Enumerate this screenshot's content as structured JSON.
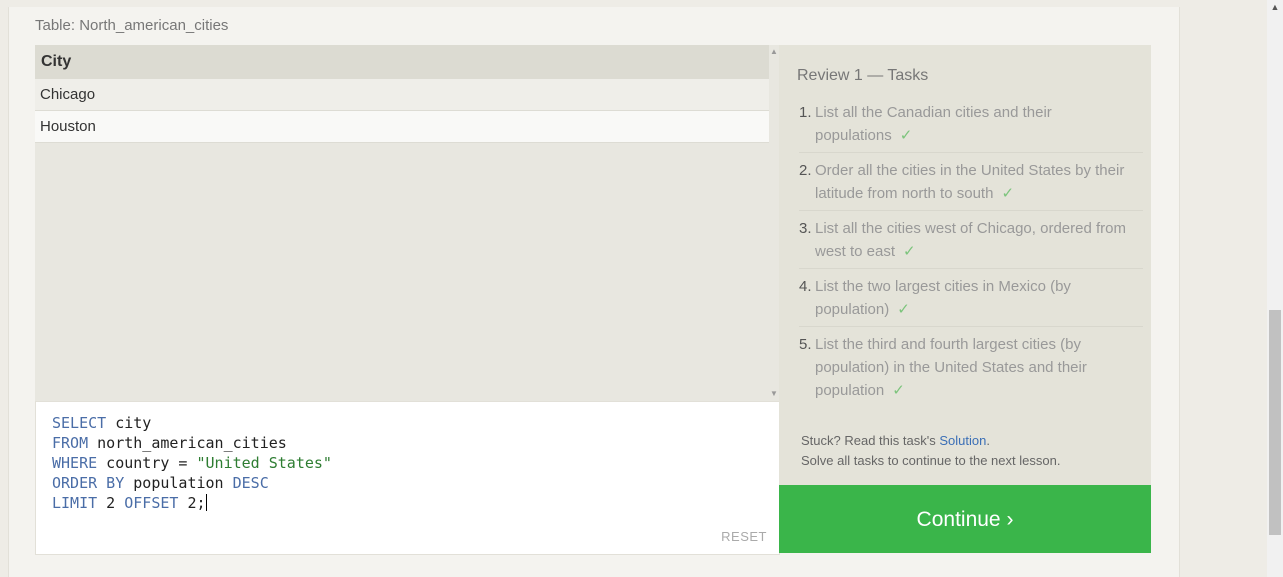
{
  "table_label": "Table: North_american_cities",
  "results": {
    "column": "City",
    "rows": [
      "Chicago",
      "Houston"
    ]
  },
  "editor": {
    "lines": [
      {
        "kw": "SELECT",
        "rest": " city"
      },
      {
        "kw": "FROM",
        "rest": " north_american_cities"
      },
      {
        "kw": "WHERE",
        "rest": " country = ",
        "str": "\"United States\""
      },
      {
        "kw": "ORDER BY",
        "rest": " population ",
        "kw2": "DESC"
      },
      {
        "kw": "LIMIT",
        "rest": " 2 ",
        "kw2": "OFFSET",
        "rest2": " 2;"
      }
    ],
    "reset_label": "RESET"
  },
  "tasks": {
    "title": "Review 1 — Tasks",
    "items": [
      {
        "num": "1.",
        "text": "List all the Canadian cities and their populations"
      },
      {
        "num": "2.",
        "text": "Order all the cities in the United States by their latitude from north to south"
      },
      {
        "num": "3.",
        "text": "List all the cities west of Chicago, ordered from west to east"
      },
      {
        "num": "4.",
        "text": "List the two largest cities in Mexico (by population)"
      },
      {
        "num": "5.",
        "text": "List the third and fourth largest cities (by population) in the United States and their population"
      }
    ],
    "check_mark": "✓",
    "stuck_prefix": "Stuck? Read this task's ",
    "solution_link": "Solution",
    "stuck_suffix": ".",
    "solve_all": "Solve all tasks to continue to the next lesson."
  },
  "continue_label": "Continue ›",
  "colors": {
    "accent": "#3ab54a",
    "keyword": "#4a6da7",
    "string": "#2e7d32",
    "check": "#7cc47c"
  }
}
